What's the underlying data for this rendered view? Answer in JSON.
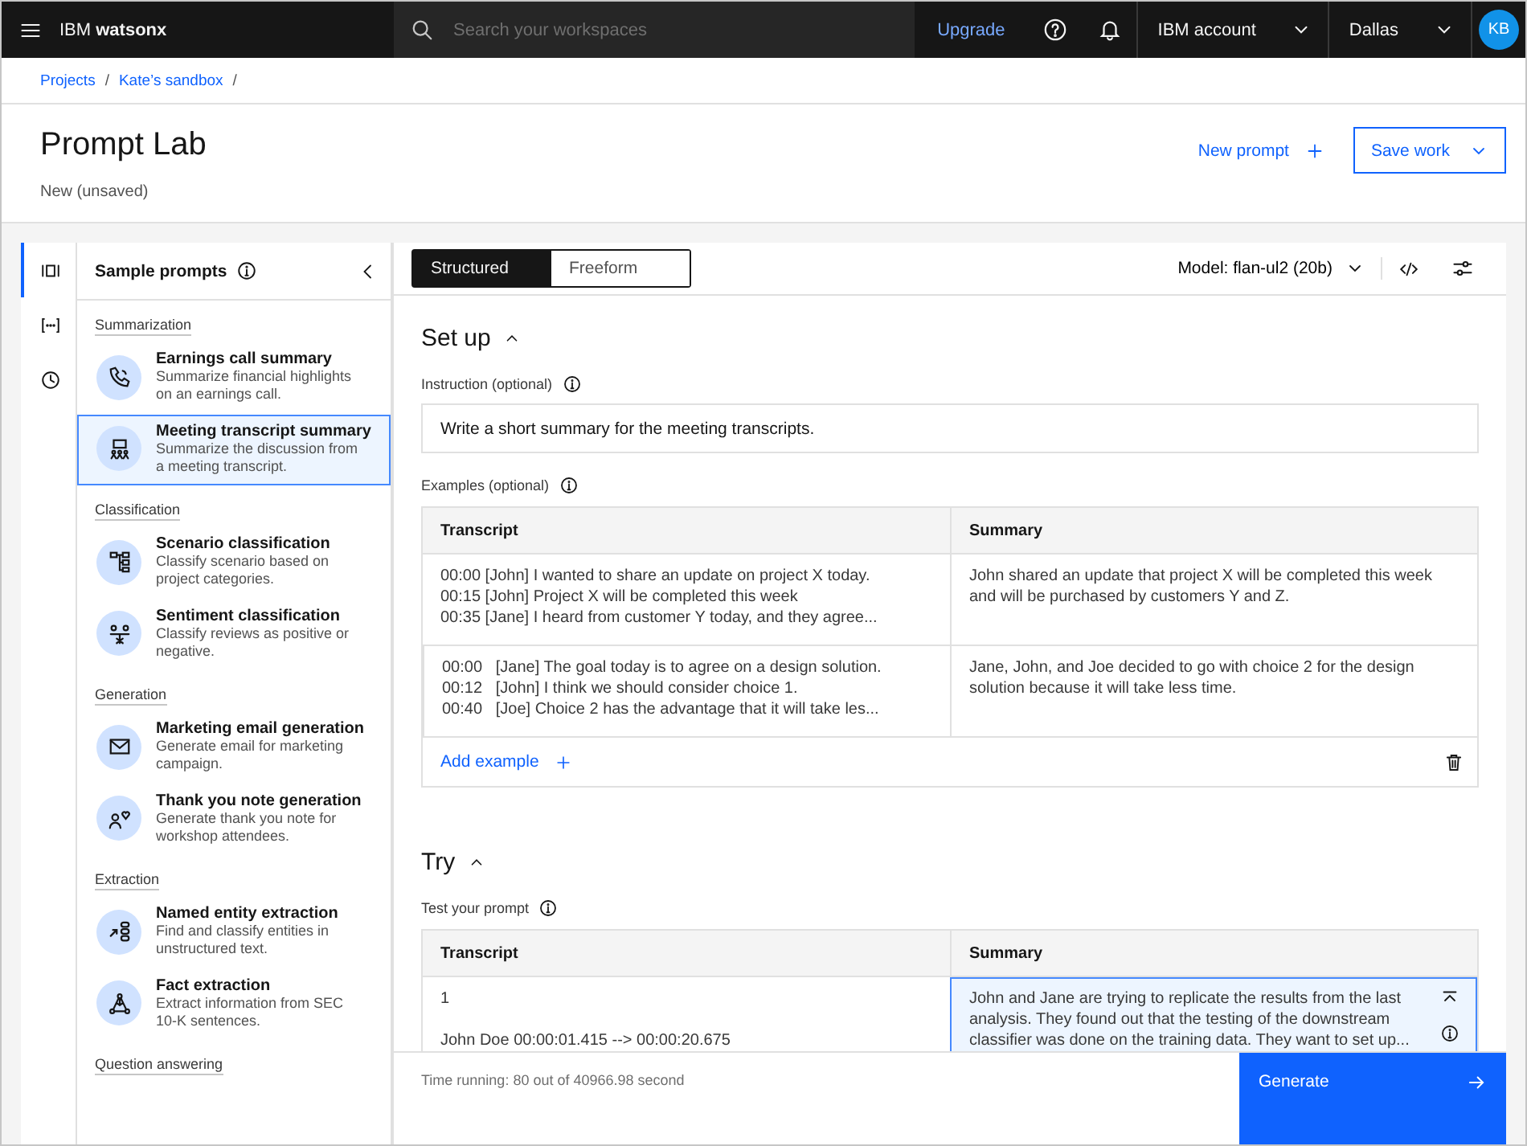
{
  "header": {
    "product": "IBM **watsonx**",
    "search": {
      "placeholder": "Search your workspaces"
    },
    "upgrade": "Upgrade",
    "account": "IBM account",
    "region": "Dallas",
    "avatar": "KB"
  },
  "breadcrumbs": {
    "separator": "/",
    "items": [
      "Projects",
      "Kate’s sandbox"
    ]
  },
  "page": {
    "title": "Prompt Lab",
    "subtitle": "New (unsaved)",
    "new_prompt": "New prompt",
    "save": "Save work"
  },
  "rail": [
    {
      "selected": true
    },
    {
      "selected": false
    },
    {
      "selected": false
    }
  ],
  "sample_panel": {
    "title": "Sample prompts",
    "groups": [
      {
        "label": "Summarization",
        "items": [
          {
            "title": "Earnings call summary",
            "description": "Summarize financial highlights on an earnings call.",
            "selected": false
          },
          {
            "title": "Meeting transcript summary",
            "description": "Summarize the discussion from a meeting transcript.",
            "selected": true
          }
        ]
      },
      {
        "label": "Classification",
        "items": [
          {
            "title": "Scenario classification",
            "description": "Classify scenario based on project categories.",
            "selected": false
          },
          {
            "title": "Sentiment classification",
            "description": "Classify reviews as positive or negative.",
            "selected": false
          }
        ]
      },
      {
        "label": "Generation",
        "items": [
          {
            "title": "Marketing email generation",
            "description": "Generate email for marketing campaign.",
            "selected": false
          },
          {
            "title": "Thank you note generation",
            "description": "Generate thank you note for workshop attendees.",
            "selected": false
          }
        ]
      },
      {
        "label": "Extraction",
        "items": [
          {
            "title": "Named entity extraction",
            "description": "Find and classify entities in unstructured text.",
            "selected": false
          },
          {
            "title": "Fact extraction",
            "description": "Extract information from SEC 10-K sentences.",
            "selected": false
          }
        ]
      },
      {
        "label": "Question answering"
      }
    ]
  },
  "mode_tabs": [
    {
      "label": "Structured",
      "selected": true
    },
    {
      "label": "Freeform",
      "selected": false
    }
  ],
  "model": "Model: flan-ul2 (20b)",
  "setup": {
    "heading": "Set up",
    "expanded": true,
    "instruction_label": "Instruction (optional)",
    "instruction": "Write a short summary for the meeting transcripts.",
    "examples_label": "Examples (optional)",
    "columns": [
      "Transcript",
      "Summary"
    ],
    "rows": [
      {
        "transcript": [
          "00:00 [John] I wanted to share an update on project X today.",
          "00:15 [John] Project X will be completed this week",
          "00:35 [Jane] I heard from customer Y today, and they agree..."
        ],
        "summary": "John shared an update that project X will be completed this week and will be purchased by customers Y and Z."
      },
      {
        "transcript": [
          "00:00   [Jane] The goal today is to agree on a design solution.",
          "00:12   [John] I think we should consider choice 1.",
          "00:40   [Joe] Choice 2 has the advantage that it will take les..."
        ],
        "summary": "Jane, John, and Joe decided to go with choice 2 for the design solution because it will take less time."
      }
    ],
    "add_example": "Add example"
  },
  "try": {
    "heading": "Try",
    "expanded": true,
    "label": "Test your prompt",
    "columns": [
      "Transcript",
      "Summary"
    ],
    "rows": [
      {
        "transcript": [
          "1",
          "John Doe 00:00:01.415 --> 00:00:20.675"
        ],
        "summary": "John and Jane are trying to replicate the results from the last analysis. They found out that the testing of the downstream classifier was done on the training data. They want to set up...",
        "selected": true
      }
    ]
  },
  "footer": {
    "status": "Time running: 80 out of 40966.98 second",
    "generate": "Generate"
  }
}
